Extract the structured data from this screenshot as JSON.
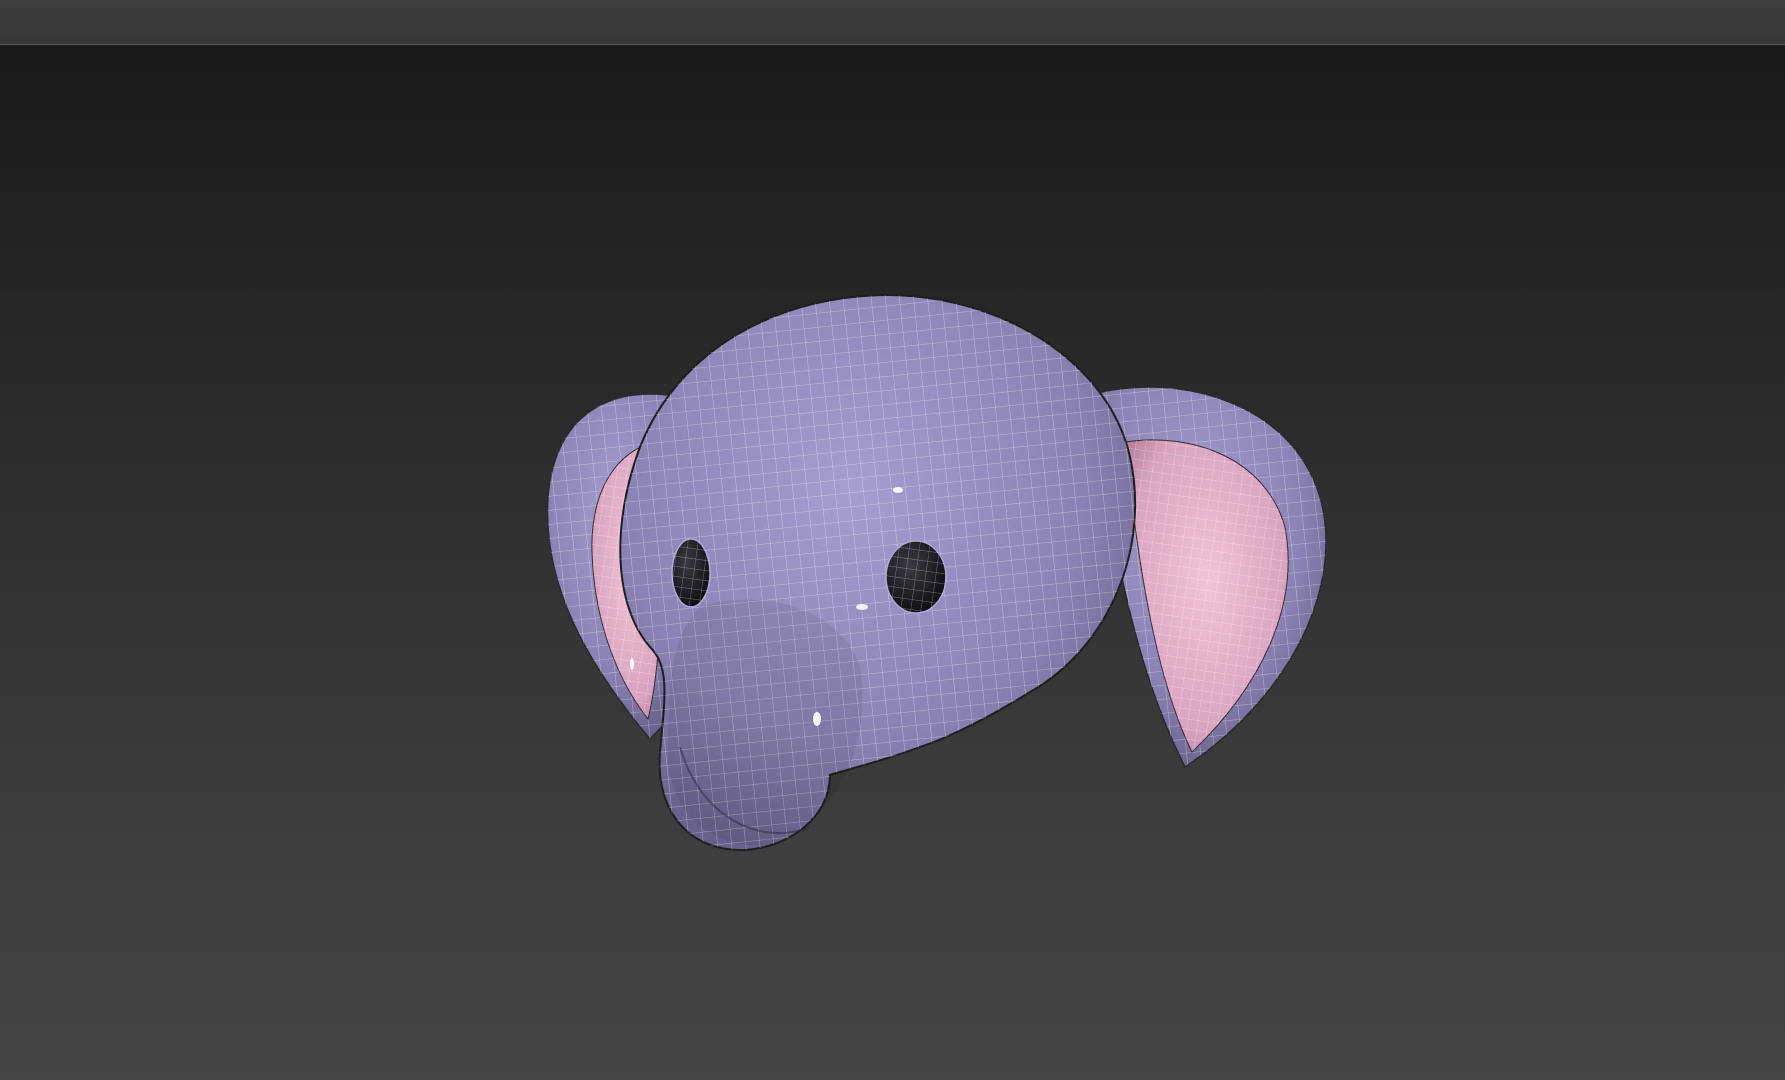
{
  "viewport": {
    "label": "",
    "background_top": "#1a1a1a",
    "background_bottom": "#454545"
  },
  "model": {
    "name": "elephant-head",
    "body_color": "#8e86b8",
    "inner_ear_color": "#e6b3cc",
    "eye_color": "#1a1a22",
    "wireframe_color": "#ffffff"
  }
}
